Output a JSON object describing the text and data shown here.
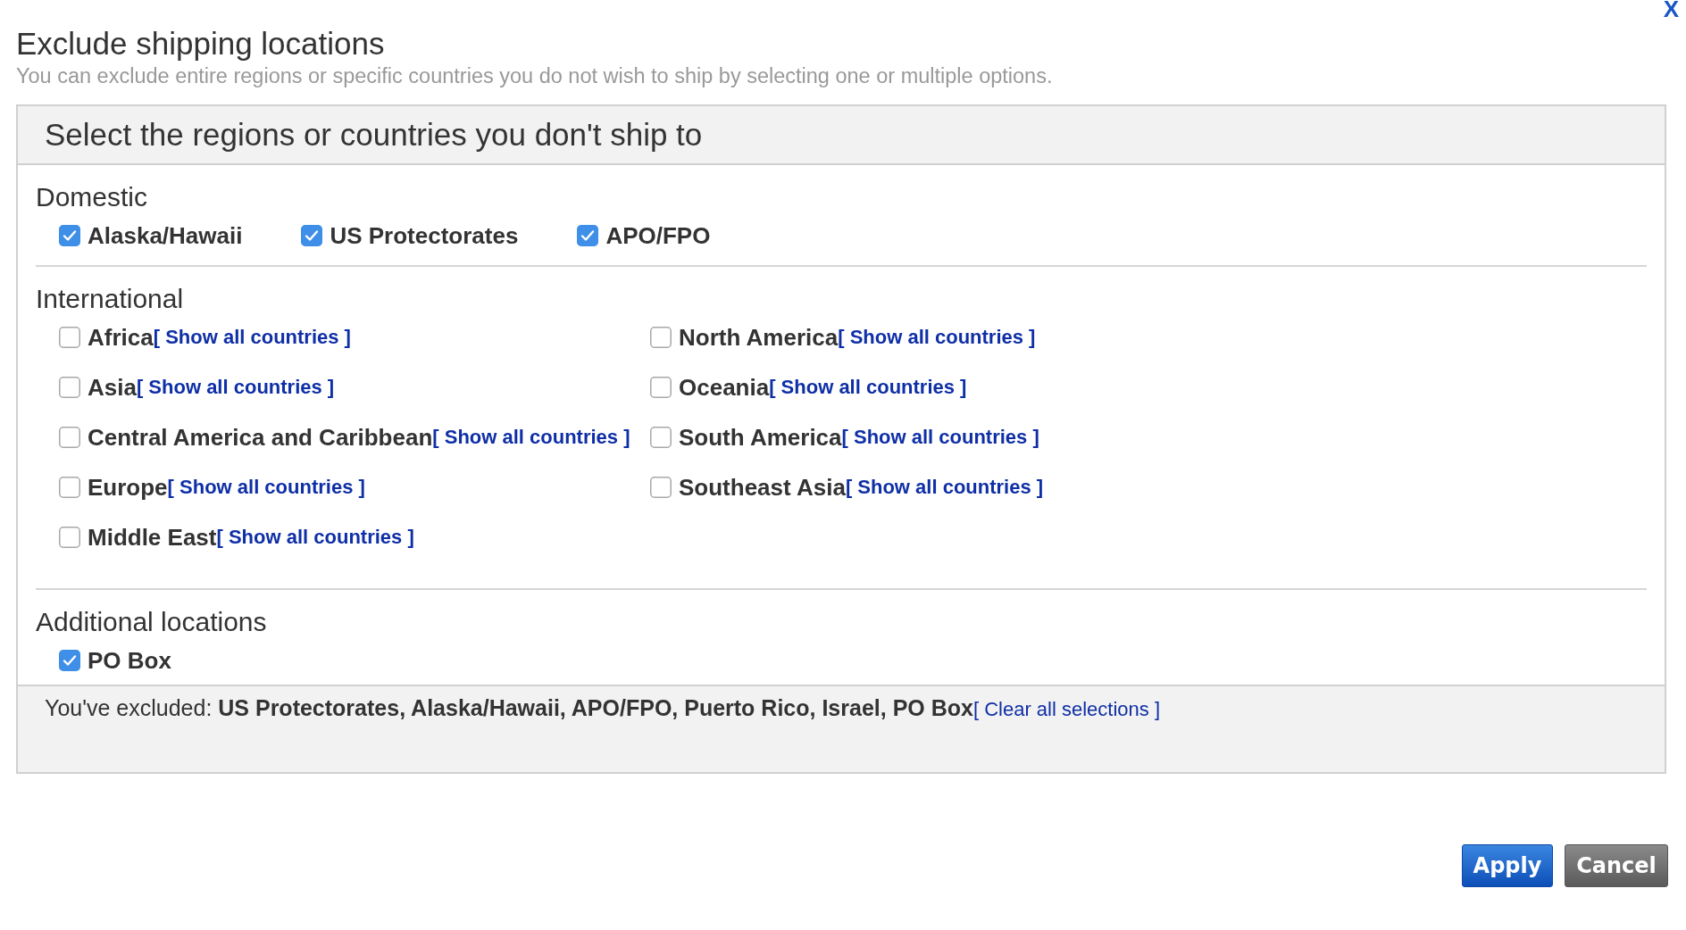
{
  "dialog": {
    "title": "Exclude shipping locations",
    "subtitle": "You can exclude entire regions or specific countries you do not wish to ship by selecting one or multiple options.",
    "close": "X"
  },
  "panel": {
    "heading": "Select the regions or countries you don't ship to",
    "domestic": {
      "label": "Domestic",
      "options": [
        {
          "label": "Alaska/Hawaii",
          "checked": true
        },
        {
          "label": "US Protectorates",
          "checked": true
        },
        {
          "label": "APO/FPO",
          "checked": true
        }
      ]
    },
    "international": {
      "label": "International",
      "columns": [
        [
          {
            "label": "Africa",
            "checked": false,
            "link": "[ Show all countries ]"
          },
          {
            "label": "Asia",
            "checked": false,
            "link": "[ Show all countries ]"
          },
          {
            "label": "Central America and Caribbean",
            "checked": false,
            "link": "[ Show all countries ]"
          },
          {
            "label": "Europe",
            "checked": false,
            "link": "[ Show all countries ]"
          },
          {
            "label": "Middle East",
            "checked": false,
            "link": "[ Show all countries ]"
          }
        ],
        [
          {
            "label": "North America",
            "checked": false,
            "link": "[ Show all countries ]"
          },
          {
            "label": "Oceania",
            "checked": false,
            "link": "[ Show all countries ]"
          },
          {
            "label": "South America",
            "checked": false,
            "link": "[ Show all countries ]"
          },
          {
            "label": "Southeast Asia",
            "checked": false,
            "link": "[ Show all countries ]"
          }
        ]
      ]
    },
    "additional": {
      "label": "Additional locations",
      "options": [
        {
          "label": "PO Box",
          "checked": true
        }
      ]
    },
    "summary": {
      "text": "You've excluded: **US Protectorates, Alaska/Hawaii, APO/FPO, Puerto Rico, Israel, PO Box**",
      "link": "[ Clear all selections ]"
    }
  },
  "buttons": [
    {
      "label": "Apply",
      "kind": "primary"
    },
    {
      "label": "Cancel",
      "kind": "secondary"
    }
  ]
}
